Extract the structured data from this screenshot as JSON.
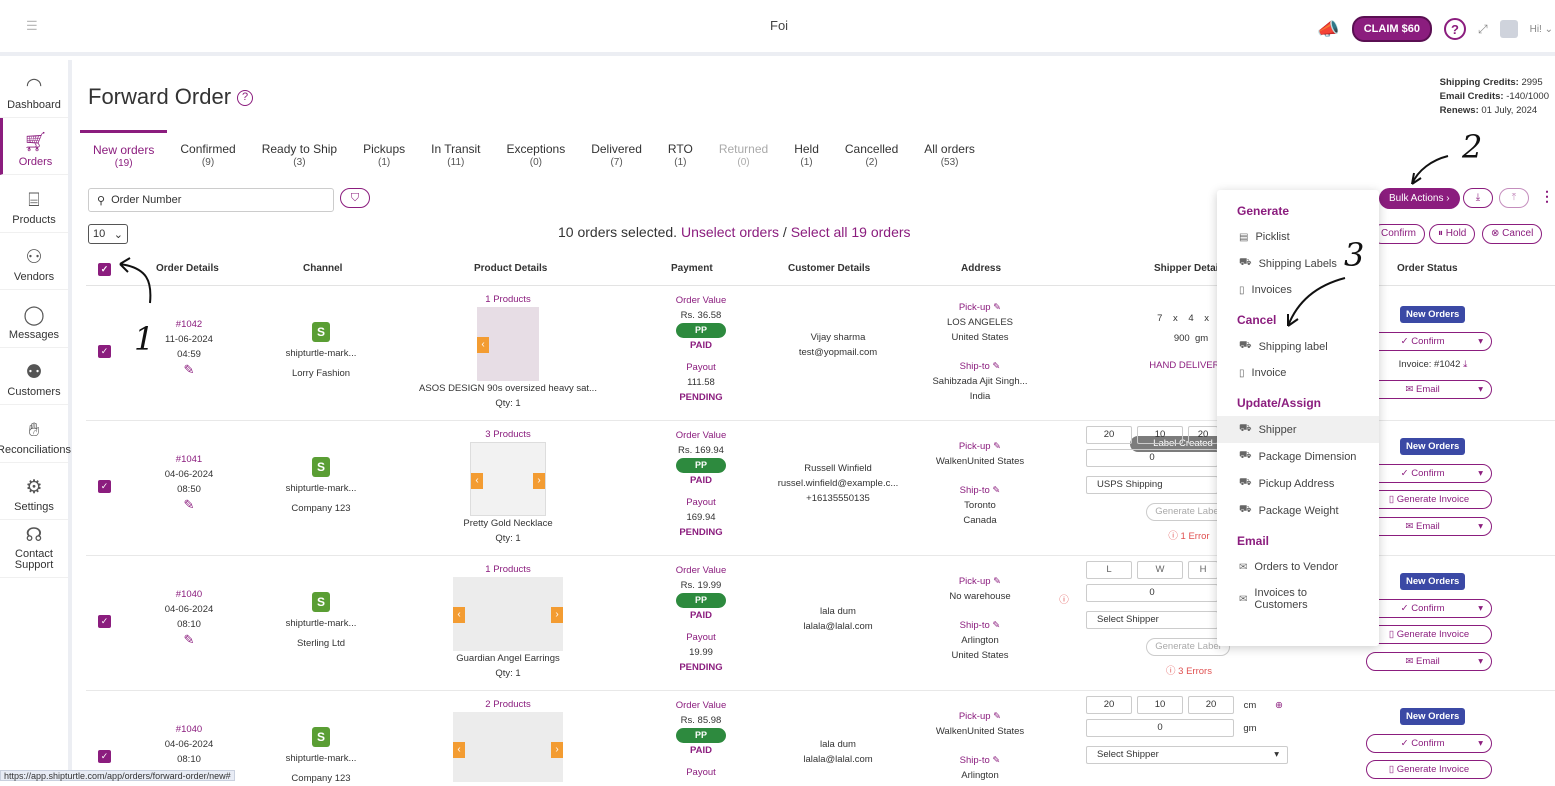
{
  "topbar": {
    "app_name": "Foi",
    "claim_label": "CLAIM $60",
    "help_label": "?",
    "expand_label": "⤢",
    "user_label": "Hi!"
  },
  "sidebar": {
    "items": [
      {
        "label": "Dashboard",
        "icon": "gauge-icon"
      },
      {
        "label": "Orders",
        "icon": "cart-icon"
      },
      {
        "label": "Products",
        "icon": "gift-icon"
      },
      {
        "label": "Vendors",
        "icon": "users-icon"
      },
      {
        "label": "Messages",
        "icon": "chat-icon"
      },
      {
        "label": "Customers",
        "icon": "customers-icon"
      },
      {
        "label": "Reconciliations",
        "icon": "handshake-icon"
      },
      {
        "label": "Settings",
        "icon": "gear-icon"
      },
      {
        "label": "Contact Support",
        "icon": "headset-icon"
      }
    ]
  },
  "page": {
    "title": "Forward Order",
    "title_help": "?"
  },
  "credits": {
    "shipping_label": "Shipping Credits:",
    "shipping_value": "2995",
    "email_label": "Email Credits:",
    "email_value": "-140/1000",
    "renews_label": "Renews:",
    "renews_value": "01 July, 2024"
  },
  "tabs": [
    {
      "label": "New orders",
      "count": "(19)"
    },
    {
      "label": "Confirmed",
      "count": "(9)"
    },
    {
      "label": "Ready to Ship",
      "count": "(3)"
    },
    {
      "label": "Pickups",
      "count": "(1)"
    },
    {
      "label": "In Transit",
      "count": "(11)"
    },
    {
      "label": "Exceptions",
      "count": "(0)"
    },
    {
      "label": "Delivered",
      "count": "(7)"
    },
    {
      "label": "RTO",
      "count": "(1)"
    },
    {
      "label": "Returned",
      "count": "(0)"
    },
    {
      "label": "Held",
      "count": "(1)"
    },
    {
      "label": "Cancelled",
      "count": "(2)"
    },
    {
      "label": "All orders",
      "count": "(53)"
    }
  ],
  "search": {
    "placeholder": "Order Number"
  },
  "pagesize": "10",
  "selection": {
    "text": "10 orders selected.",
    "unselect": "Unselect orders",
    "sep": "/",
    "select_all": "Select all 19 orders"
  },
  "toolbar": {
    "bulk_actions": "Bulk Actions ›",
    "download": "⤓",
    "upload": "⤒",
    "more": "⋮",
    "confirm": "Confirm",
    "hold": "Hold",
    "cancel": "Cancel"
  },
  "table_headers": {
    "order_details": "Order Details",
    "channel": "Channel",
    "product_details": "Product Details",
    "payment": "Payment",
    "customer_details": "Customer Details",
    "address": "Address",
    "shipper_details": "Shipper Details",
    "order_status": "Order Status"
  },
  "rows": [
    {
      "order_no": "#1042",
      "date": "11-06-2024",
      "time": "04:59",
      "channel": "shipturtle-mark...",
      "vendor": "Lorry Fashion",
      "products_count": "1 Products",
      "product_name": "ASOS DESIGN 90s oversized heavy sat...",
      "qty": "Qty: 1",
      "order_value_label": "Order Value",
      "order_value": "Rs. 36.58",
      "pay_type": "PP",
      "pay_status": "PAID",
      "payout_label": "Payout",
      "payout": "111.58",
      "payout_status": "PENDING",
      "customer_name": "Vijay sharma",
      "customer_email": "test@yopmail.com",
      "customer_phone": "",
      "pickup_label": "Pick-up",
      "pickup_line1": "LOS ANGELES",
      "pickup_line2": "United States",
      "shipto_label": "Ship-to",
      "shipto_line1": "Sahibzada Ajit Singh...",
      "shipto_line2": "India",
      "status": "New Orders",
      "confirm": "Confirm",
      "third_btn": "Email"
    },
    {
      "order_no": "#1041",
      "date": "04-06-2024",
      "time": "08:50",
      "channel": "shipturtle-mark...",
      "vendor": "Company 123",
      "products_count": "3 Products",
      "product_name": "Pretty Gold Necklace",
      "qty": "Qty: 1",
      "order_value_label": "Order Value",
      "order_value": "Rs. 169.94",
      "pay_type": "PP",
      "pay_status": "PAID",
      "payout_label": "Payout",
      "payout": "169.94",
      "payout_status": "PENDING",
      "customer_name": "Russell Winfield",
      "customer_email": "russel.winfield@example.c...",
      "customer_phone": "+16135550135",
      "pickup_label": "Pick-up",
      "pickup_line1": "WalkenUnited States",
      "pickup_line2": "",
      "shipto_label": "Ship-to",
      "shipto_line1": "Toronto",
      "shipto_line2": "Canada",
      "status": "New Orders",
      "confirm": "Confirm",
      "second_btn": "Generate Invoice",
      "third_btn": "Email"
    },
    {
      "order_no": "#1040",
      "date": "04-06-2024",
      "time": "08:10",
      "channel": "shipturtle-mark...",
      "vendor": "Sterling Ltd",
      "products_count": "1 Products",
      "product_name": "Guardian Angel Earrings",
      "qty": "Qty: 1",
      "order_value_label": "Order Value",
      "order_value": "Rs. 19.99",
      "pay_type": "PP",
      "pay_status": "PAID",
      "payout_label": "Payout",
      "payout": "19.99",
      "payout_status": "PENDING",
      "customer_name": "lala dum",
      "customer_email": "lalala@lalal.com",
      "customer_phone": "",
      "pickup_label": "Pick-up",
      "pickup_line1": "No warehouse",
      "pickup_line2": "",
      "shipto_label": "Ship-to",
      "shipto_line1": "Arlington",
      "shipto_line2": "United States",
      "status": "New Orders",
      "confirm": "Confirm",
      "second_btn": "Generate Invoice",
      "third_btn": "Email"
    },
    {
      "order_no": "#1040",
      "date": "04-06-2024",
      "time": "08:10",
      "channel": "shipturtle-mark...",
      "vendor": "Company 123",
      "products_count": "2 Products",
      "product_name": "",
      "qty": "",
      "order_value_label": "Order Value",
      "order_value": "Rs. 85.98",
      "pay_type": "PP",
      "pay_status": "PAID",
      "payout_label": "Payout",
      "payout": "",
      "payout_status": "",
      "customer_name": "lala dum",
      "customer_email": "lalala@lalal.com",
      "customer_phone": "",
      "pickup_label": "Pick-up",
      "pickup_line1": "WalkenUnited States",
      "pickup_line2": "",
      "shipto_label": "Ship-to",
      "shipto_line1": "Arlington",
      "shipto_line2": "",
      "status": "New Orders",
      "confirm": "Confirm",
      "second_btn": "Generate Invoice"
    }
  ],
  "shipper": {
    "row1": {
      "l": "7",
      "x1": "x",
      "w": "4",
      "x2": "x",
      "h": "3",
      "weight": "900",
      "unit": "gm",
      "delivery": "HAND DELIVERED",
      "label_status": "Label Created",
      "invoice": "Invoice: #1042"
    },
    "row2": {
      "l": "20",
      "w": "10",
      "h": "20",
      "weight": "0",
      "shipper": "USPS Shipping",
      "gen_label": "Generate Label",
      "error": "ⓘ 1 Error"
    },
    "row3": {
      "l": "L",
      "w": "W",
      "h": "H",
      "weight": "0",
      "shipper": "Select Shipper",
      "gen_label": "Generate Label",
      "error": "ⓘ 3 Errors"
    },
    "row4": {
      "l": "20",
      "w": "10",
      "h": "20",
      "unit_dim": "cm",
      "weight": "0",
      "unit": "gm",
      "shipper": "Select Shipper"
    }
  },
  "bulk_menu": {
    "generate": "Generate",
    "picklist": "Picklist",
    "shipping_labels": "Shipping Labels",
    "invoices": "Invoices",
    "cancel": "Cancel",
    "shipping_label": "Shipping label",
    "invoice": "Invoice",
    "update_assign": "Update/Assign",
    "shipper": "Shipper",
    "package_dimension": "Package Dimension",
    "pickup_address": "Pickup Address",
    "package_weight": "Package Weight",
    "email": "Email",
    "orders_to_vendor": "Orders to Vendor",
    "invoices_to_customers": "Invoices to Customers"
  },
  "annotations": {
    "one": "1",
    "two": "2",
    "three": "3"
  },
  "status_url": "https://app.shipturtle.com/app/orders/forward-order/new#"
}
